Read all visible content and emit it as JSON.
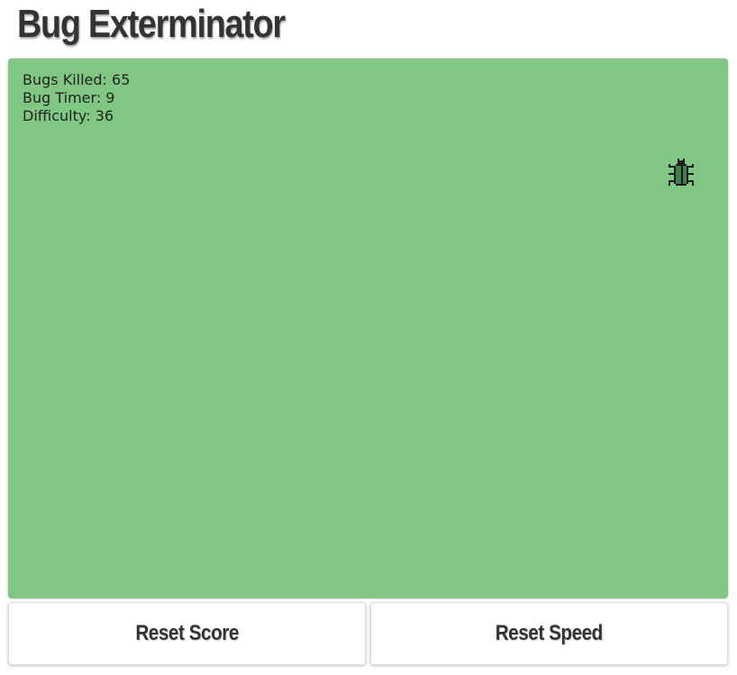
{
  "app": {
    "title": "Bug Exterminator"
  },
  "board": {
    "background": "#81c784",
    "stats": {
      "bugs_killed_label": "Bugs Killed:",
      "bugs_killed": "65",
      "bug_timer_label": "Bug Timer:",
      "bug_timer": "9",
      "difficulty_label": "Difficulty:",
      "difficulty": "36"
    },
    "bug": {
      "icon": "bug-icon",
      "color": "#1a1a1a",
      "body_color": "#3f7f4f"
    }
  },
  "controls": {
    "reset_score_label": "Reset Score",
    "reset_speed_label": "Reset Speed"
  }
}
